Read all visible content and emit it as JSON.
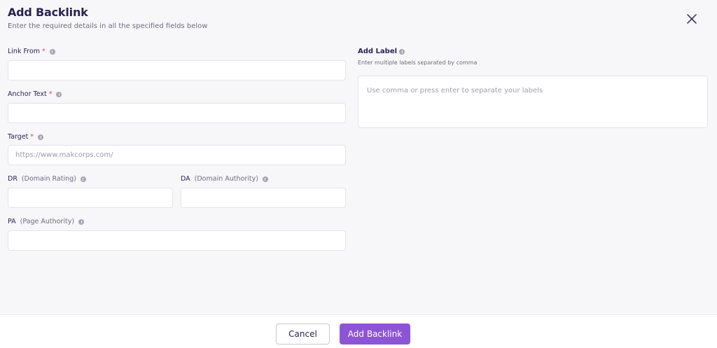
{
  "modal": {
    "title": "Add Backlink",
    "subtitle": "Enter the required details in all the specified fields below"
  },
  "fields": {
    "link_from": {
      "label": "Link From",
      "required": "*",
      "value": "",
      "placeholder": ""
    },
    "anchor_text": {
      "label": "Anchor Text",
      "required": "*",
      "value": "",
      "placeholder": ""
    },
    "target": {
      "label": "Target",
      "required": "*",
      "value": "",
      "placeholder": "https://www.makcorps.com/"
    },
    "dr": {
      "label": "DR",
      "hint": "(Domain Rating)",
      "value": "",
      "placeholder": ""
    },
    "da": {
      "label": "DA",
      "hint": "(Domain Authority)",
      "value": "",
      "placeholder": ""
    },
    "pa": {
      "label": "PA",
      "hint": "(Page Authority)",
      "value": "",
      "placeholder": ""
    }
  },
  "labels": {
    "title": "Add Label",
    "subtitle": "Enter multiple labels separated by comma",
    "placeholder": "Use comma or press enter to separate your labels"
  },
  "footer": {
    "cancel_label": "Cancel",
    "submit_label": "Add Backlink"
  },
  "colors": {
    "primary": "#8d55d6",
    "required": "#d9465a",
    "title": "#2b2350"
  },
  "icons": {
    "close": "close-icon",
    "info": "info-icon"
  }
}
